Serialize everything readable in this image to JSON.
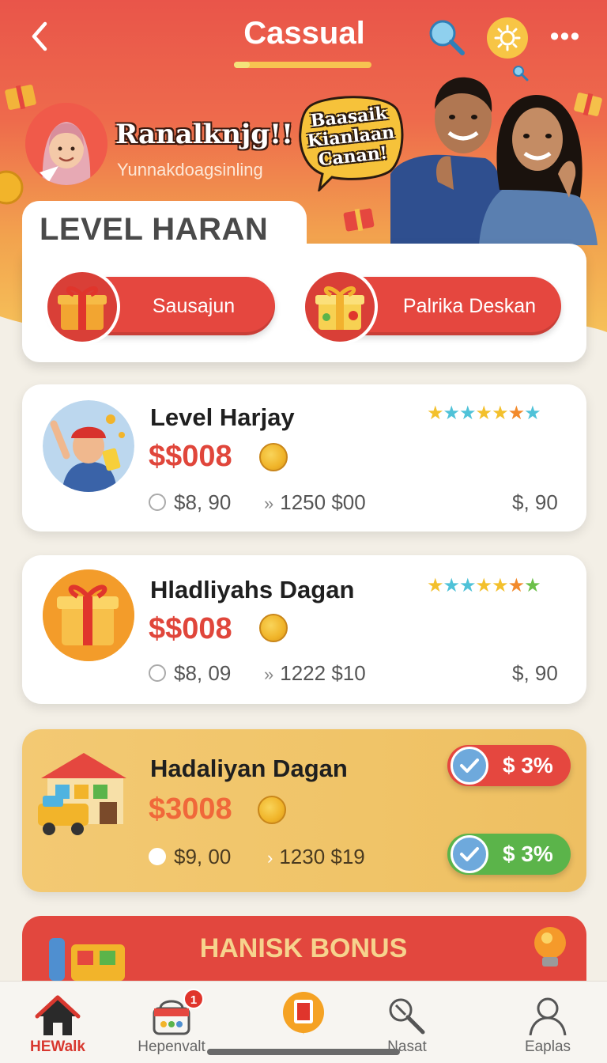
{
  "header": {
    "title": "Cassual",
    "back_icon": "chevron-left-icon",
    "search_icon": "search-icon",
    "settings_icon": "sun-gear-icon",
    "more_label": "•••"
  },
  "profile": {
    "name": "Ranalknjg!!",
    "subtitle": "Yunnakdoagsinling",
    "speech_bubble": "Baasaik Kianlaan Canan!"
  },
  "level": {
    "title": "LEVEL HARAN",
    "buttons": [
      {
        "label": "Sausajun",
        "icon": "gift-icon"
      },
      {
        "label": "Palrika Deskan",
        "icon": "gift-icon"
      }
    ]
  },
  "offers": [
    {
      "title": "Level Harjay",
      "price": "$$008",
      "meta_left": "$8, 90",
      "meta_mid": "1250 $00",
      "meta_right": "$, 90",
      "stars": [
        "#f3c02c",
        "#4fc2d8",
        "#4fc2d8",
        "#f3c02c",
        "#f3c02c",
        "#f28a2c",
        "#4fc2d8"
      ]
    },
    {
      "title": "Hladliyahs Dagan",
      "price": "$$008",
      "meta_left": "$8, 09",
      "meta_mid": "1222 $10",
      "meta_right": "$, 90",
      "stars": [
        "#f3c02c",
        "#4fc2d8",
        "#4fc2d8",
        "#f3c02c",
        "#f3c02c",
        "#f28a2c",
        "#6cc04a"
      ]
    },
    {
      "title": "Hadaliyan Dagan",
      "price": "$3008",
      "meta_left": "$9, 00",
      "meta_mid": "1230 $19",
      "badges": [
        {
          "label": "$ 3%",
          "color": "#e5473f"
        },
        {
          "label": "$ 3%",
          "color": "#5bb44a"
        }
      ]
    }
  ],
  "bonus": {
    "title": "HANISK BONUS"
  },
  "nav": {
    "items": [
      {
        "label": "HEWalk",
        "icon": "home-icon"
      },
      {
        "label": "Hepenvalt",
        "icon": "basket-icon",
        "badge": "1"
      },
      {
        "label": "",
        "icon": "clipboard-icon"
      },
      {
        "label": "Nasat",
        "icon": "wrench-icon"
      },
      {
        "label": "Eaplas",
        "icon": "user-icon"
      }
    ]
  },
  "colors": {
    "primary_red": "#e5473f",
    "accent_gold": "#f7c545",
    "green": "#5bb44a"
  }
}
